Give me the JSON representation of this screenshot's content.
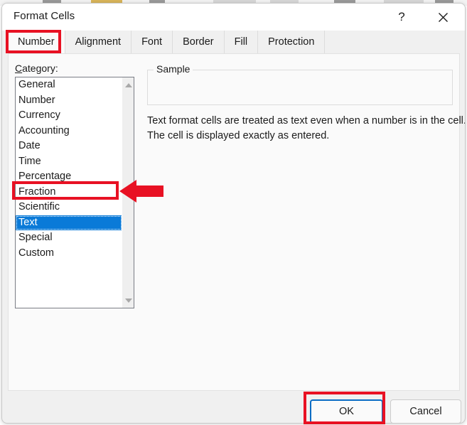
{
  "window": {
    "title": "Format Cells",
    "help_label": "?",
    "close_label": "✕"
  },
  "tabs": [
    {
      "label": "Number",
      "active": true
    },
    {
      "label": "Alignment",
      "active": false
    },
    {
      "label": "Font",
      "active": false
    },
    {
      "label": "Border",
      "active": false
    },
    {
      "label": "Fill",
      "active": false
    },
    {
      "label": "Protection",
      "active": false
    }
  ],
  "category": {
    "label_prefix": "C",
    "label_rest": "ategory:",
    "items": [
      "General",
      "Number",
      "Currency",
      "Accounting",
      "Date",
      "Time",
      "Percentage",
      "Fraction",
      "Scientific",
      "Text",
      "Special",
      "Custom"
    ],
    "selected": "Text",
    "scroll_up_icon": "triangle-up-icon",
    "scroll_down_icon": "triangle-down-icon"
  },
  "sample": {
    "legend": "Sample",
    "value": ""
  },
  "description": {
    "line1": "Text format cells are treated as text even when a number is in the cell.",
    "line2": "The cell is displayed exactly as entered."
  },
  "footer": {
    "ok_label": "OK",
    "cancel_label": "Cancel"
  },
  "annotations": {
    "color": "#E81123",
    "rect_tab": "Number",
    "rect_list_item": "Text",
    "rect_button": "OK",
    "arrow": "left-arrow-icon"
  },
  "colors": {
    "selection_blue": "#0A7AD8",
    "focus_border_blue": "#0A6CC4",
    "dialog_bg": "#F0F0F0",
    "panel_bg": "#FAFAFA",
    "annotation_red": "#E81123"
  }
}
